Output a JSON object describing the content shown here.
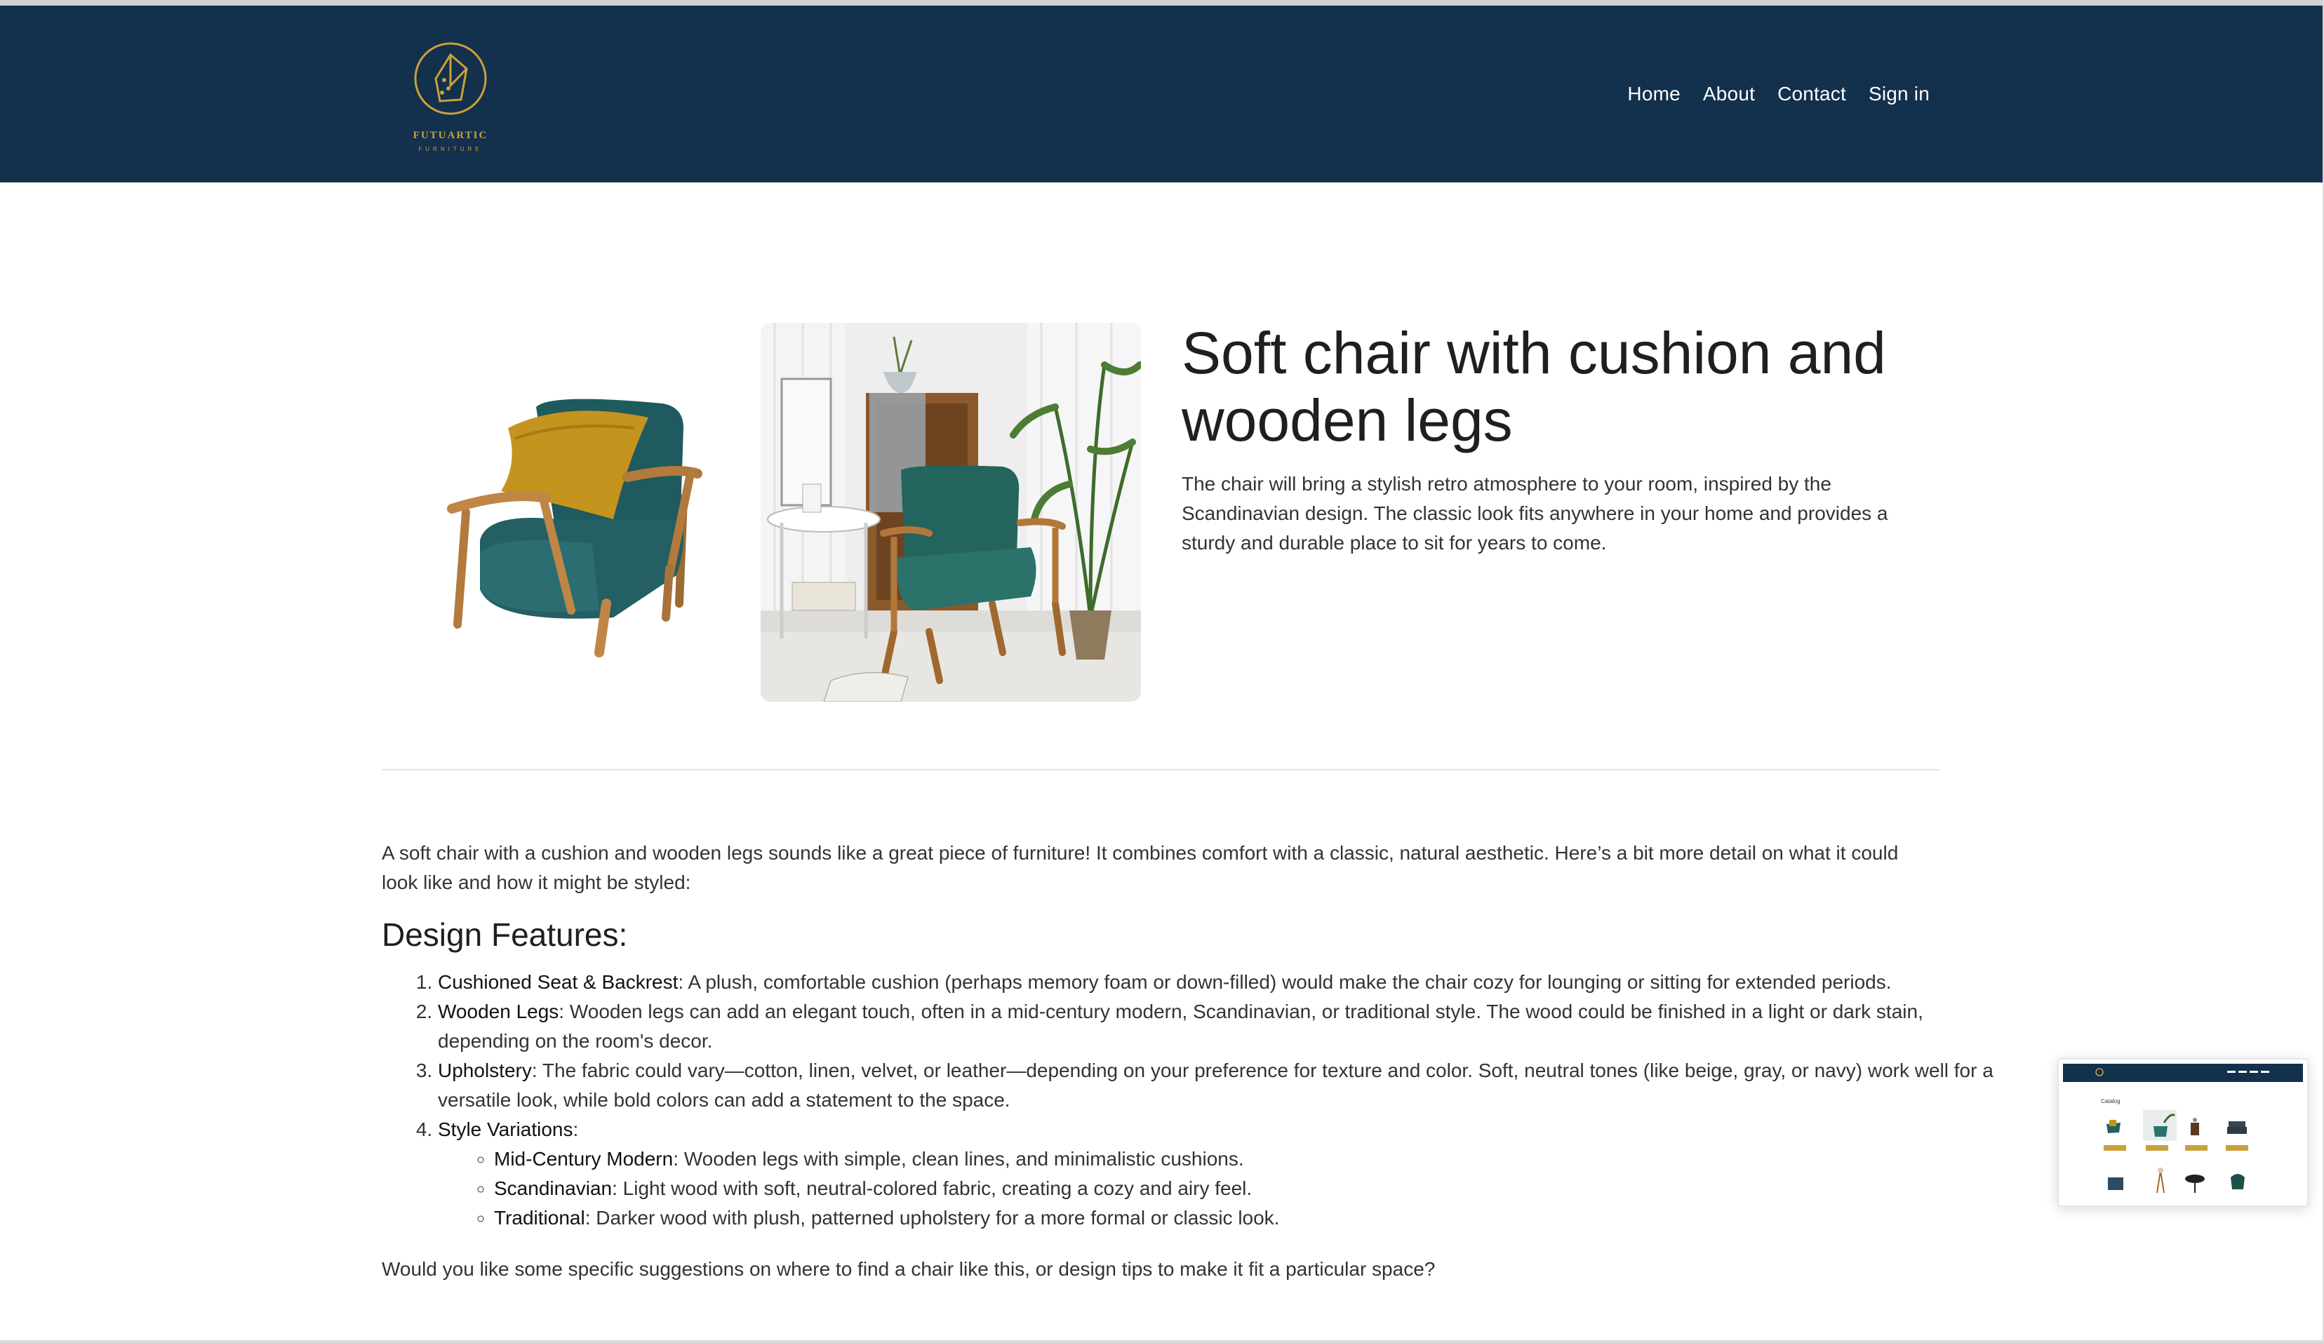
{
  "brand": {
    "name": "FUTUARTIC",
    "tagline": "FURNITURE",
    "colors": {
      "header": "#13304d",
      "accent": "#c9a13b"
    }
  },
  "nav": {
    "items": [
      {
        "label": "Home"
      },
      {
        "label": "About"
      },
      {
        "label": "Contact"
      },
      {
        "label": "Sign in"
      }
    ]
  },
  "product": {
    "title": "Soft chair with cushion and wooden legs",
    "description": "The chair will bring a stylish retro atmosphere to your room, inspired by the Scandinavian design. The classic look fits anywhere in your home and provides a sturdy and durable place to sit for years to come.",
    "images": [
      {
        "icon": "chair-with-cushion-photo"
      },
      {
        "icon": "chair-in-room-photo"
      }
    ]
  },
  "details": {
    "intro": "A soft chair with a cushion and wooden legs sounds like a great piece of furniture! It combines comfort with a classic, natural aesthetic. Here’s a bit more detail on what it could look like and how it might be styled:",
    "section_title": "Design Features:",
    "features": [
      {
        "term": "Cushioned Seat & Backrest",
        "text": ": A plush, comfortable cushion (perhaps memory foam or down-filled) would make the chair cozy for lounging or sitting for extended periods."
      },
      {
        "term": "Wooden Legs",
        "text": ": Wooden legs can add an elegant touch, often in a mid-century modern, Scandinavian, or traditional style. The wood could be finished in a light or dark stain, depending on the room's decor."
      },
      {
        "term": "Upholstery",
        "text": ": The fabric could vary—cotton, linen, velvet, or leather—depending on your preference for texture and color. Soft, neutral tones (like beige, gray, or navy) work well for a versatile look, while bold colors can add a statement to the space."
      },
      {
        "term": "Style Variations",
        "text": ":"
      }
    ],
    "style_variations": [
      {
        "term": "Mid-Century Modern",
        "text": ": Wooden legs with simple, clean lines, and minimalistic cushions."
      },
      {
        "term": "Scandinavian",
        "text": ": Light wood with soft, neutral-colored fabric, creating a cozy and airy feel."
      },
      {
        "term": "Traditional",
        "text": ": Darker wood with plush, patterned upholstery for a more formal or classic look."
      }
    ],
    "closing": "Would you like some specific suggestions on where to find a chair like this, or design tips to make it fit a particular space?"
  },
  "thumbnail": {
    "heading": "Catalog"
  }
}
